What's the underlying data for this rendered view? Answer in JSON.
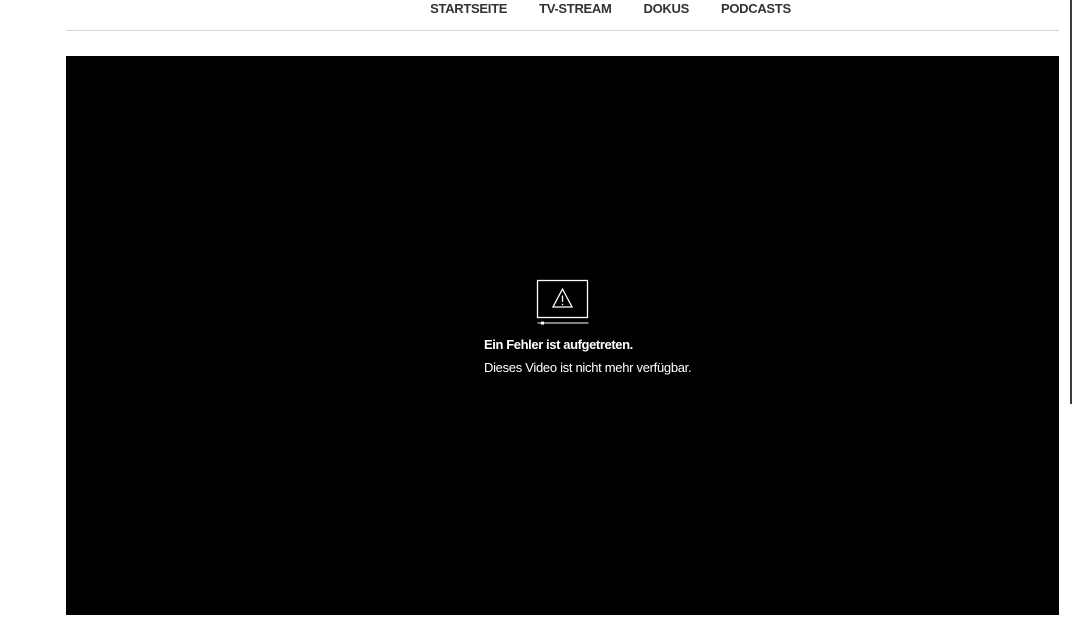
{
  "nav": {
    "items": [
      {
        "label": "STARTSEITE"
      },
      {
        "label": "TV-STREAM"
      },
      {
        "label": "DOKUS"
      },
      {
        "label": "PODCASTS"
      }
    ]
  },
  "player": {
    "error_icon": "monitor-warning-icon",
    "error_title": "Ein Fehler ist aufgetreten.",
    "error_message": "Dieses Video ist nicht mehr verfügbar."
  },
  "colors": {
    "nav_text": "#333333",
    "player_background": "#000000",
    "player_text": "#ffffff",
    "divider": "#d6d6d6"
  }
}
